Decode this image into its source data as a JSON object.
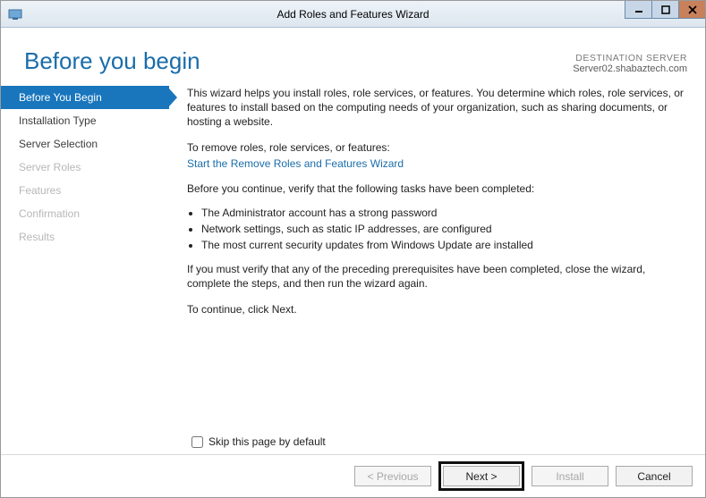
{
  "window": {
    "title": "Add Roles and Features Wizard"
  },
  "header": {
    "page_title": "Before you begin",
    "dest_label": "DESTINATION SERVER",
    "dest_server": "Server02.shabaztech.com"
  },
  "sidebar": {
    "items": [
      {
        "label": "Before You Begin",
        "state": "active"
      },
      {
        "label": "Installation Type",
        "state": "normal"
      },
      {
        "label": "Server Selection",
        "state": "normal"
      },
      {
        "label": "Server Roles",
        "state": "disabled"
      },
      {
        "label": "Features",
        "state": "disabled"
      },
      {
        "label": "Confirmation",
        "state": "disabled"
      },
      {
        "label": "Results",
        "state": "disabled"
      }
    ]
  },
  "main": {
    "intro": "This wizard helps you install roles, role services, or features. You determine which roles, role services, or features to install based on the computing needs of your organization, such as sharing documents, or hosting a website.",
    "remove_lead": "To remove roles, role services, or features:",
    "remove_link": "Start the Remove Roles and Features Wizard",
    "verify_lead": "Before you continue, verify that the following tasks have been completed:",
    "bullets": [
      "The Administrator account has a strong password",
      "Network settings, such as static IP addresses, are configured",
      "The most current security updates from Windows Update are installed"
    ],
    "verify_trailer": "If you must verify that any of the preceding prerequisites have been completed, close the wizard, complete the steps, and then run the wizard again.",
    "continue_line": "To continue, click Next.",
    "skip_label": "Skip this page by default"
  },
  "footer": {
    "previous": "< Previous",
    "next": "Next >",
    "install": "Install",
    "cancel": "Cancel"
  }
}
